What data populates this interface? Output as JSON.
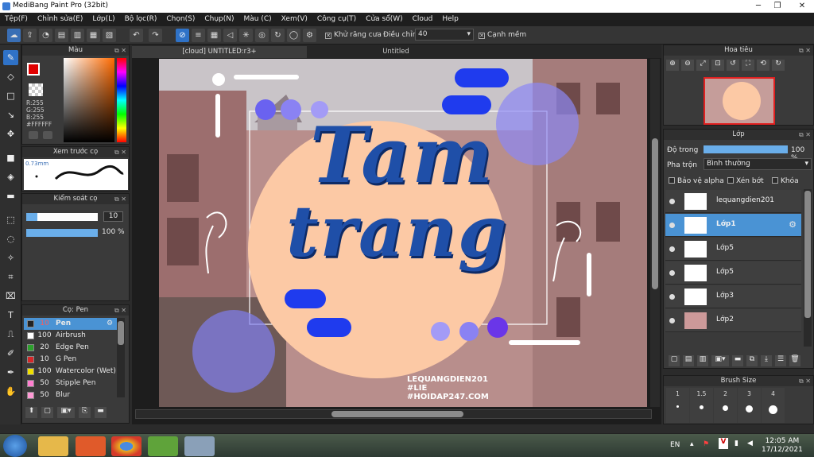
{
  "window": {
    "title": "MediBang Paint Pro (32bit)"
  },
  "menu": [
    "Tệp(F)",
    "Chỉnh sửa(E)",
    "Lớp(L)",
    "Bộ lọc(R)",
    "Chọn(S)",
    "Chụp(N)",
    "Màu (C)",
    "Xem(V)",
    "Công cụ(T)",
    "Cửa sổ(W)",
    "Cloud",
    "Help"
  ],
  "toolbar": {
    "antialias_label": "Khử răng cưa",
    "adjust_label": "Điều chỉnh",
    "adjust_value": "40",
    "snap_label": "Cạnh mềm"
  },
  "tabs": [
    "[cloud] UNTITLED:r3+",
    "Untitled"
  ],
  "color_panel": {
    "title": "Màu",
    "r": "R:255",
    "g": "G:255",
    "b": "B:255",
    "hex": "#FFFFFF",
    "primary": "#e00000",
    "secondary": "#ffffff"
  },
  "brush_preview": {
    "title": "Xem trước cọ",
    "size": "0.73mm"
  },
  "brush_control": {
    "title": "Kiểm soát cọ",
    "size_value": "10",
    "opacity_value": "100 %"
  },
  "brush_list": {
    "title": "Cọ: Pen",
    "items": [
      {
        "size": "10",
        "name": "Pen",
        "color": "#222222"
      },
      {
        "size": "100",
        "name": "Airbrush",
        "color": "#ffffff"
      },
      {
        "size": "20",
        "name": "Edge Pen",
        "color": "#2ca02c"
      },
      {
        "size": "10",
        "name": "G Pen",
        "color": "#d62728"
      },
      {
        "size": "100",
        "name": "Watercolor (Wet)",
        "color": "#f0e000"
      },
      {
        "size": "50",
        "name": "Stipple Pen",
        "color": "#ff7fd0"
      },
      {
        "size": "50",
        "name": "Blur",
        "color": "#ff9ad5"
      }
    ]
  },
  "navigator": {
    "title": "Hoa tiêu"
  },
  "layers_panel": {
    "title": "Lớp",
    "opacity_label": "Độ trong",
    "opacity_value": "100 %",
    "blend_label": "Pha trộn",
    "blend_value": "Bình thường",
    "protect_alpha": "Bảo vệ alpha",
    "clip": "Xén bớt",
    "lock": "Khóa",
    "layers": [
      "lequangdien201",
      "Lớp1",
      "Lớp5",
      "Lớp5",
      "Lớp3",
      "Lớp2"
    ]
  },
  "brush_size": {
    "title": "Brush Size",
    "sizes": [
      "1",
      "1.5",
      "2",
      "3",
      "4"
    ]
  },
  "artwork": {
    "line1": "Tam",
    "line2": "trang",
    "credit1": "LEQUANGDIEN201",
    "credit2": "#LIE",
    "credit3": "#HOIDAP247.COM"
  },
  "taskbar": {
    "lang": "EN",
    "time": "12:05 AM",
    "date": "17/12/2021"
  },
  "colors": {
    "accent": "#2f72c7",
    "peach": "#fcc9a5",
    "lettering": "#1f4fa8"
  }
}
